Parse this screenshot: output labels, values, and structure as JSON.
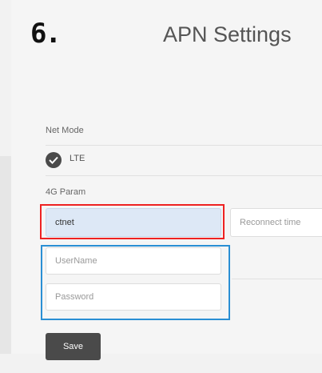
{
  "header": {
    "step": "6.",
    "title": "APN Settings"
  },
  "form": {
    "net_mode_label": "Net Mode",
    "net_mode_value": "LTE",
    "param_label": "4G Param",
    "apn_value": "ctnet",
    "reconnect_placeholder": "Reconnect time",
    "username_placeholder": "UserName",
    "password_placeholder": "Password",
    "save_label": "Save"
  },
  "colors": {
    "highlight_red": "#e22222",
    "highlight_blue": "#2a8fd4",
    "button": "#4a4a4a",
    "filled_input": "#dde8f6"
  }
}
